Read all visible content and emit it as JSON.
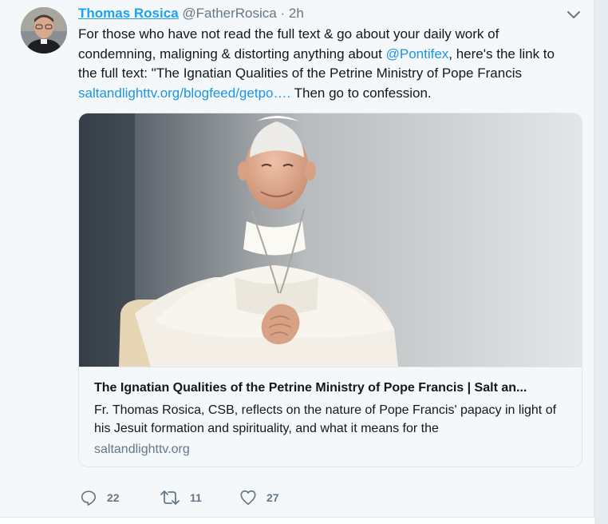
{
  "tweet": {
    "author_name": "Thomas Rosica",
    "author_handle": "@FatherRosica",
    "separator": " · ",
    "time": "2h",
    "text_part1": "For those who have not read the full text & go about your daily work of condemning, maligning & distorting anything about ",
    "mention": "@Pontifex",
    "text_part2": ", here's the link to the full text: \"The Ignatian Qualities of the Petrine Ministry of Pope Francis ",
    "link": "saltandlighttv.org/blogfeed/getpo….",
    "text_part3": " Then go to confession."
  },
  "card": {
    "title": "The Ignatian Qualities of the Petrine Ministry of Pope Francis | Salt an...",
    "description": "Fr. Thomas Rosica, CSB, reflects on the nature of Pope Francis' papacy in light of his Jesuit formation and spirituality, and what it means for the",
    "domain": "saltandlighttv.org"
  },
  "actions": {
    "reply_count": "22",
    "retweet_count": "11",
    "like_count": "27"
  },
  "icons": {
    "caret": "chevron-down-icon",
    "reply": "reply-icon",
    "retweet": "retweet-icon",
    "like": "heart-icon"
  },
  "colors": {
    "link": "#1b95e0",
    "name": "#1da1f2",
    "muted": "#657786",
    "background": "#f5f8fa"
  }
}
